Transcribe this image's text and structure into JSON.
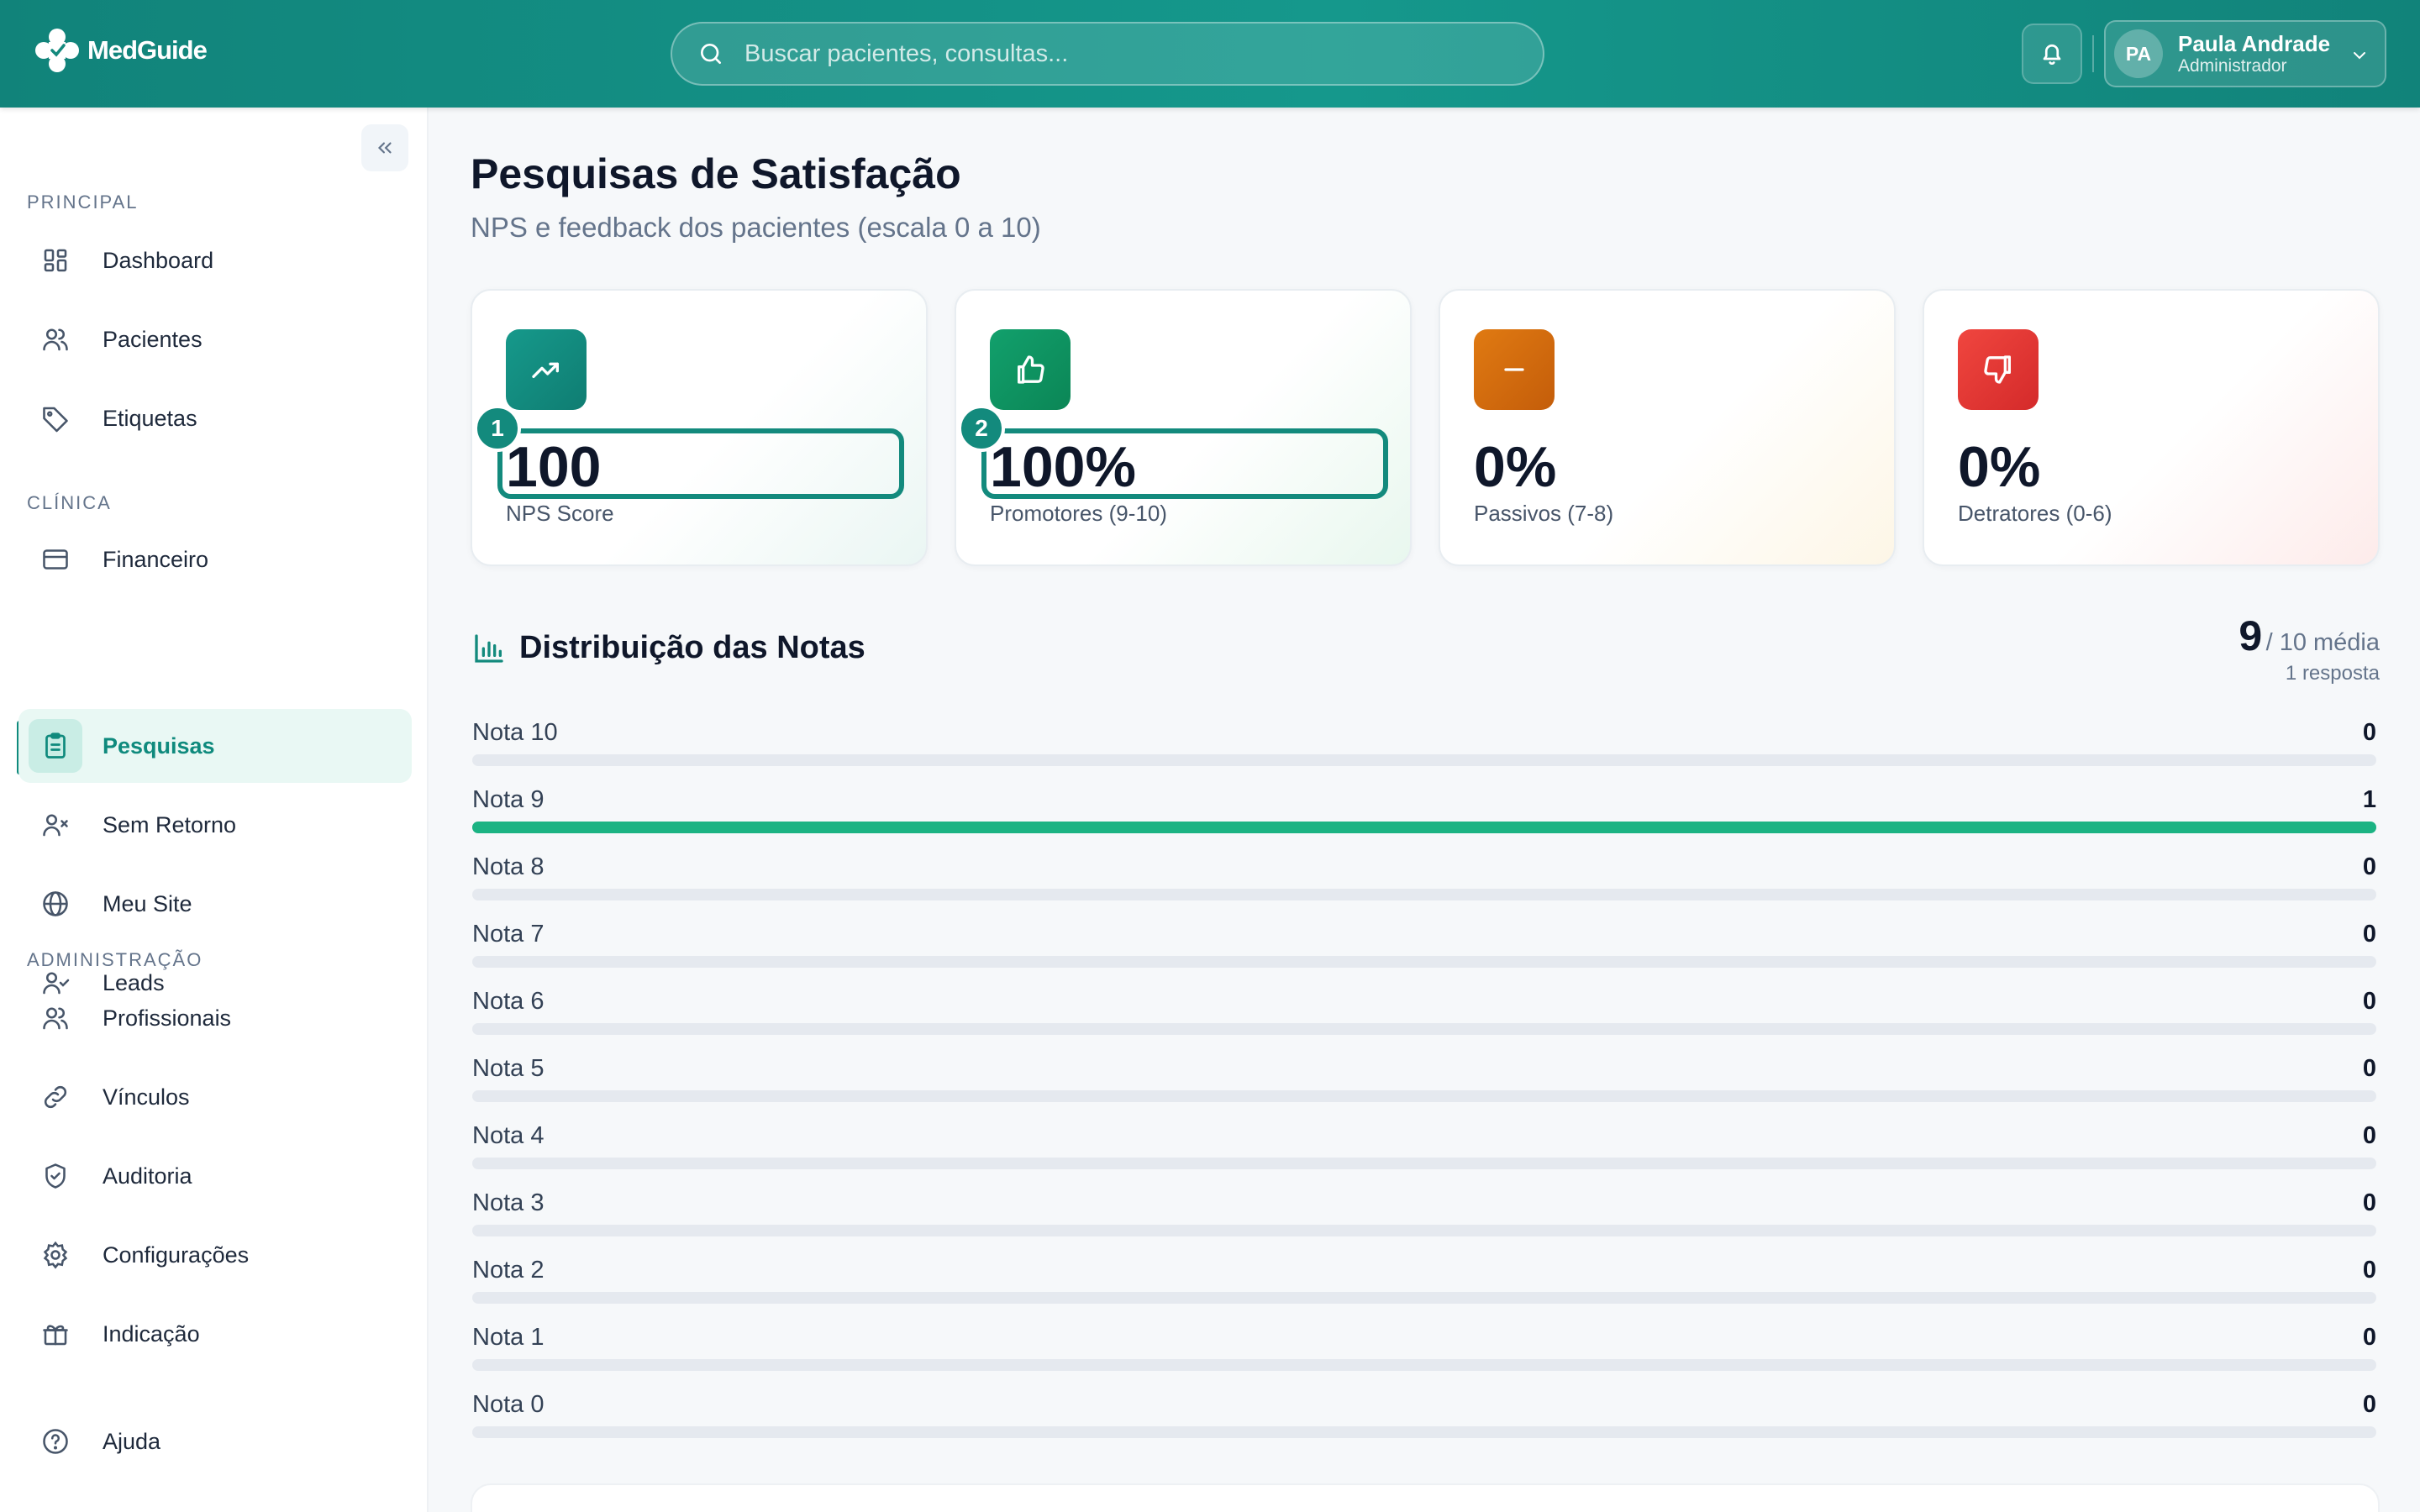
{
  "app": {
    "name": "MedGuide"
  },
  "search": {
    "placeholder": "Buscar pacientes, consultas..."
  },
  "user": {
    "initials": "PA",
    "name": "Paula Andrade",
    "role": "Administrador"
  },
  "sidebar": {
    "sections": [
      {
        "title": "PRINCIPAL",
        "items": [
          {
            "label": "Dashboard",
            "icon": "grid-icon"
          },
          {
            "label": "Pacientes",
            "icon": "users-icon"
          },
          {
            "label": "Etiquetas",
            "icon": "tag-icon"
          }
        ]
      },
      {
        "title": "CLÍNICA",
        "items": [
          {
            "label": "Financeiro",
            "icon": "credit-card-icon"
          },
          {
            "label": "Pesquisas",
            "icon": "clipboard-icon",
            "active": true
          },
          {
            "label": "Sem Retorno",
            "icon": "user-x-icon"
          },
          {
            "label": "Meu Site",
            "icon": "globe-icon"
          },
          {
            "label": "Leads",
            "icon": "user-check-icon"
          }
        ]
      },
      {
        "title": "ADMINISTRAÇÃO",
        "items": [
          {
            "label": "Profissionais",
            "icon": "users-icon"
          },
          {
            "label": "Vínculos",
            "icon": "link-icon"
          },
          {
            "label": "Auditoria",
            "icon": "shield-icon"
          },
          {
            "label": "Configurações",
            "icon": "gear-icon"
          },
          {
            "label": "Indicação",
            "icon": "gift-icon"
          }
        ]
      }
    ],
    "help": {
      "label": "Ajuda",
      "icon": "help-circle-icon"
    }
  },
  "page": {
    "title": "Pesquisas de Satisfação",
    "subtitle": "NPS e feedback dos pacientes (escala 0 a 10)"
  },
  "stats": [
    {
      "value": "100",
      "label": "NPS Score",
      "icon": "trending-up-icon",
      "color": "#138a7d",
      "badge": "1"
    },
    {
      "value": "100%",
      "label": "Promotores (9-10)",
      "icon": "thumbs-up-icon",
      "color": "#0e9466",
      "badge": "2"
    },
    {
      "value": "0%",
      "label": "Passivos (7-8)",
      "icon": "minus-icon",
      "color": "#d46a0c"
    },
    {
      "value": "0%",
      "label": "Detratores (0-6)",
      "icon": "thumbs-down-icon",
      "color": "#e53935"
    }
  ],
  "distribution": {
    "title": "Distribuição das Notas",
    "average": "9",
    "average_suffix": "/ 10 média",
    "responses": "1 resposta",
    "rows": [
      {
        "label": "Nota 10",
        "count": "0",
        "fraction": 0
      },
      {
        "label": "Nota 9",
        "count": "1",
        "fraction": 1
      },
      {
        "label": "Nota 8",
        "count": "0",
        "fraction": 0
      },
      {
        "label": "Nota 7",
        "count": "0",
        "fraction": 0
      },
      {
        "label": "Nota 6",
        "count": "0",
        "fraction": 0
      },
      {
        "label": "Nota 5",
        "count": "0",
        "fraction": 0
      },
      {
        "label": "Nota 4",
        "count": "0",
        "fraction": 0
      },
      {
        "label": "Nota 3",
        "count": "0",
        "fraction": 0
      },
      {
        "label": "Nota 2",
        "count": "0",
        "fraction": 0
      },
      {
        "label": "Nota 1",
        "count": "0",
        "fraction": 0
      },
      {
        "label": "Nota 0",
        "count": "0",
        "fraction": 0
      }
    ]
  },
  "colors": {
    "brand": "#138a7d",
    "bar_fill": "#1bb383",
    "bar_track": "#e5e9ef"
  }
}
